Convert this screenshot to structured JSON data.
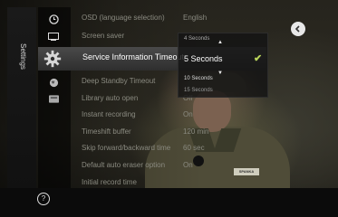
{
  "sidebar": {
    "label": "Settings"
  },
  "menu": {
    "rows": [
      {
        "label": "OSD (language selection)",
        "value": "English"
      },
      {
        "label": "Screen saver",
        "value": ""
      },
      {
        "label": "Service Information Timeout",
        "value": ""
      },
      {
        "label": "Deep Standby Timeout",
        "value": ""
      },
      {
        "label": "Library auto open",
        "value": "Off"
      },
      {
        "label": "Instant recording",
        "value": "On"
      },
      {
        "label": "Timeshift buffer",
        "value": "120 min"
      },
      {
        "label": "Skip forward/backward time",
        "value": "60 sec"
      },
      {
        "label": "Default auto eraser option",
        "value": "On"
      },
      {
        "label": "Initial record time",
        "value": ""
      }
    ]
  },
  "dropdown": {
    "options": [
      "4 Seconds",
      "5 Seconds",
      "10 Seconds",
      "15 Seconds"
    ],
    "selected": "5 Seconds"
  },
  "scene": {
    "nametag": "SPANKA"
  },
  "colors": {
    "check": "#b9d45a",
    "row_highlight": "#3c3c3c"
  }
}
